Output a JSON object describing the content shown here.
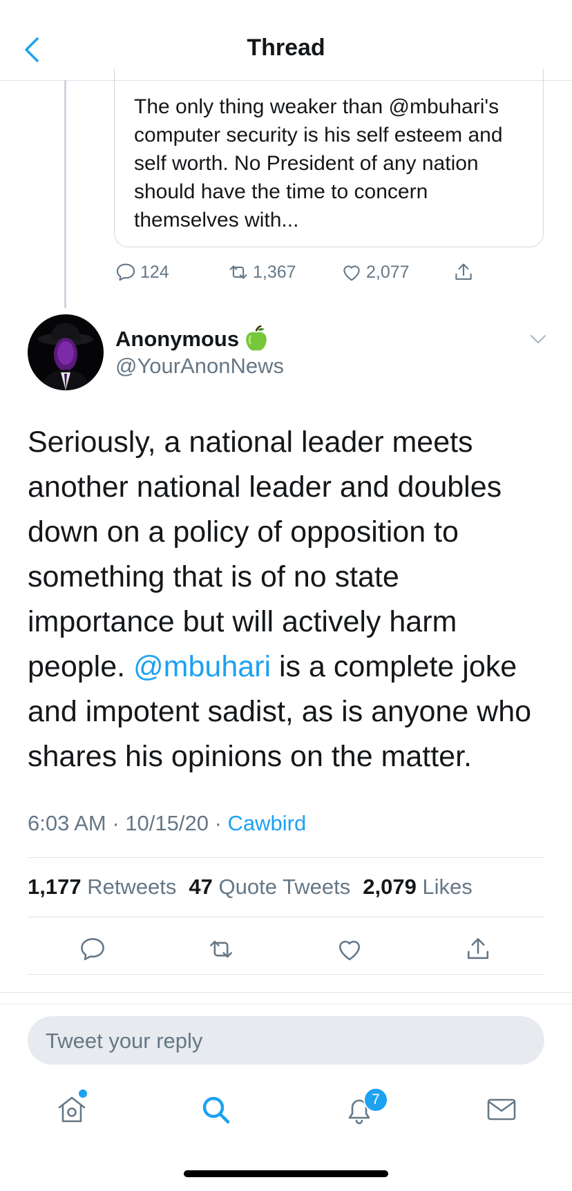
{
  "header": {
    "title": "Thread"
  },
  "quoted_tweet": {
    "text": "The only thing weaker than @mbuhari's computer security is his self esteem and self worth. No President of any nation should have the time to concern themselves with...",
    "actions": {
      "replies": "124",
      "retweets": "1,367",
      "likes": "2,077"
    }
  },
  "tweet": {
    "display_name": "Anonymous",
    "handle": "@YourAnonNews",
    "text_before": "Seriously, a national leader meets another national leader and doubles down on a policy of opposition to something that is of no state importance but will actively harm people. ",
    "mention": "@mbuhari",
    "text_after": " is a complete joke and impotent sadist, as is anyone who shares his opinions on the matter.",
    "time": "6:03 AM · 10/15/20 · ",
    "source": "Cawbird",
    "stats": {
      "retweets_count": "1,177",
      "retweets_label": " Retweets",
      "quotes_count": "47",
      "quotes_label": " Quote Tweets",
      "likes_count": "2,079",
      "likes_label": " Likes"
    }
  },
  "reply": {
    "placeholder": "Tweet your reply"
  },
  "nav": {
    "notification_count": "7"
  },
  "colors": {
    "accent": "#1da1f2",
    "muted": "#657786",
    "text": "#14171a",
    "divider": "#dfe3e6"
  },
  "icons": [
    "back-chevron-icon",
    "reply-icon",
    "retweet-icon",
    "like-icon",
    "share-icon",
    "green-apple-icon",
    "chevron-down-icon",
    "home-icon",
    "search-icon",
    "notifications-icon",
    "messages-icon"
  ]
}
